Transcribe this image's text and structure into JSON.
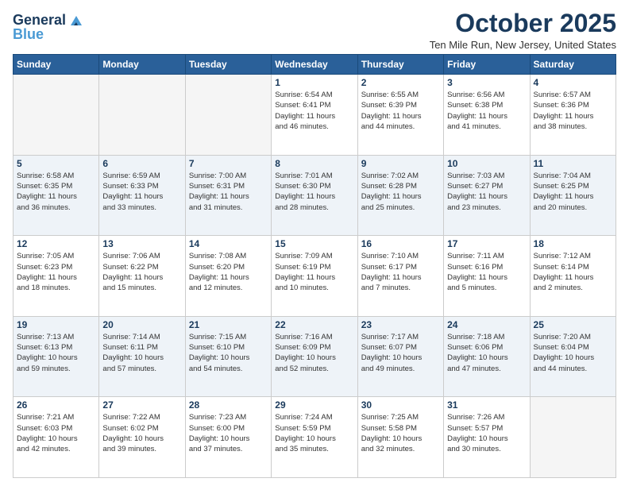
{
  "header": {
    "logo_line1": "General",
    "logo_line2": "Blue",
    "month": "October 2025",
    "location": "Ten Mile Run, New Jersey, United States"
  },
  "days_of_week": [
    "Sunday",
    "Monday",
    "Tuesday",
    "Wednesday",
    "Thursday",
    "Friday",
    "Saturday"
  ],
  "weeks": [
    [
      {
        "day": "",
        "info": ""
      },
      {
        "day": "",
        "info": ""
      },
      {
        "day": "",
        "info": ""
      },
      {
        "day": "1",
        "info": "Sunrise: 6:54 AM\nSunset: 6:41 PM\nDaylight: 11 hours\nand 46 minutes."
      },
      {
        "day": "2",
        "info": "Sunrise: 6:55 AM\nSunset: 6:39 PM\nDaylight: 11 hours\nand 44 minutes."
      },
      {
        "day": "3",
        "info": "Sunrise: 6:56 AM\nSunset: 6:38 PM\nDaylight: 11 hours\nand 41 minutes."
      },
      {
        "day": "4",
        "info": "Sunrise: 6:57 AM\nSunset: 6:36 PM\nDaylight: 11 hours\nand 38 minutes."
      }
    ],
    [
      {
        "day": "5",
        "info": "Sunrise: 6:58 AM\nSunset: 6:35 PM\nDaylight: 11 hours\nand 36 minutes."
      },
      {
        "day": "6",
        "info": "Sunrise: 6:59 AM\nSunset: 6:33 PM\nDaylight: 11 hours\nand 33 minutes."
      },
      {
        "day": "7",
        "info": "Sunrise: 7:00 AM\nSunset: 6:31 PM\nDaylight: 11 hours\nand 31 minutes."
      },
      {
        "day": "8",
        "info": "Sunrise: 7:01 AM\nSunset: 6:30 PM\nDaylight: 11 hours\nand 28 minutes."
      },
      {
        "day": "9",
        "info": "Sunrise: 7:02 AM\nSunset: 6:28 PM\nDaylight: 11 hours\nand 25 minutes."
      },
      {
        "day": "10",
        "info": "Sunrise: 7:03 AM\nSunset: 6:27 PM\nDaylight: 11 hours\nand 23 minutes."
      },
      {
        "day": "11",
        "info": "Sunrise: 7:04 AM\nSunset: 6:25 PM\nDaylight: 11 hours\nand 20 minutes."
      }
    ],
    [
      {
        "day": "12",
        "info": "Sunrise: 7:05 AM\nSunset: 6:23 PM\nDaylight: 11 hours\nand 18 minutes."
      },
      {
        "day": "13",
        "info": "Sunrise: 7:06 AM\nSunset: 6:22 PM\nDaylight: 11 hours\nand 15 minutes."
      },
      {
        "day": "14",
        "info": "Sunrise: 7:08 AM\nSunset: 6:20 PM\nDaylight: 11 hours\nand 12 minutes."
      },
      {
        "day": "15",
        "info": "Sunrise: 7:09 AM\nSunset: 6:19 PM\nDaylight: 11 hours\nand 10 minutes."
      },
      {
        "day": "16",
        "info": "Sunrise: 7:10 AM\nSunset: 6:17 PM\nDaylight: 11 hours\nand 7 minutes."
      },
      {
        "day": "17",
        "info": "Sunrise: 7:11 AM\nSunset: 6:16 PM\nDaylight: 11 hours\nand 5 minutes."
      },
      {
        "day": "18",
        "info": "Sunrise: 7:12 AM\nSunset: 6:14 PM\nDaylight: 11 hours\nand 2 minutes."
      }
    ],
    [
      {
        "day": "19",
        "info": "Sunrise: 7:13 AM\nSunset: 6:13 PM\nDaylight: 10 hours\nand 59 minutes."
      },
      {
        "day": "20",
        "info": "Sunrise: 7:14 AM\nSunset: 6:11 PM\nDaylight: 10 hours\nand 57 minutes."
      },
      {
        "day": "21",
        "info": "Sunrise: 7:15 AM\nSunset: 6:10 PM\nDaylight: 10 hours\nand 54 minutes."
      },
      {
        "day": "22",
        "info": "Sunrise: 7:16 AM\nSunset: 6:09 PM\nDaylight: 10 hours\nand 52 minutes."
      },
      {
        "day": "23",
        "info": "Sunrise: 7:17 AM\nSunset: 6:07 PM\nDaylight: 10 hours\nand 49 minutes."
      },
      {
        "day": "24",
        "info": "Sunrise: 7:18 AM\nSunset: 6:06 PM\nDaylight: 10 hours\nand 47 minutes."
      },
      {
        "day": "25",
        "info": "Sunrise: 7:20 AM\nSunset: 6:04 PM\nDaylight: 10 hours\nand 44 minutes."
      }
    ],
    [
      {
        "day": "26",
        "info": "Sunrise: 7:21 AM\nSunset: 6:03 PM\nDaylight: 10 hours\nand 42 minutes."
      },
      {
        "day": "27",
        "info": "Sunrise: 7:22 AM\nSunset: 6:02 PM\nDaylight: 10 hours\nand 39 minutes."
      },
      {
        "day": "28",
        "info": "Sunrise: 7:23 AM\nSunset: 6:00 PM\nDaylight: 10 hours\nand 37 minutes."
      },
      {
        "day": "29",
        "info": "Sunrise: 7:24 AM\nSunset: 5:59 PM\nDaylight: 10 hours\nand 35 minutes."
      },
      {
        "day": "30",
        "info": "Sunrise: 7:25 AM\nSunset: 5:58 PM\nDaylight: 10 hours\nand 32 minutes."
      },
      {
        "day": "31",
        "info": "Sunrise: 7:26 AM\nSunset: 5:57 PM\nDaylight: 10 hours\nand 30 minutes."
      },
      {
        "day": "",
        "info": ""
      }
    ]
  ]
}
